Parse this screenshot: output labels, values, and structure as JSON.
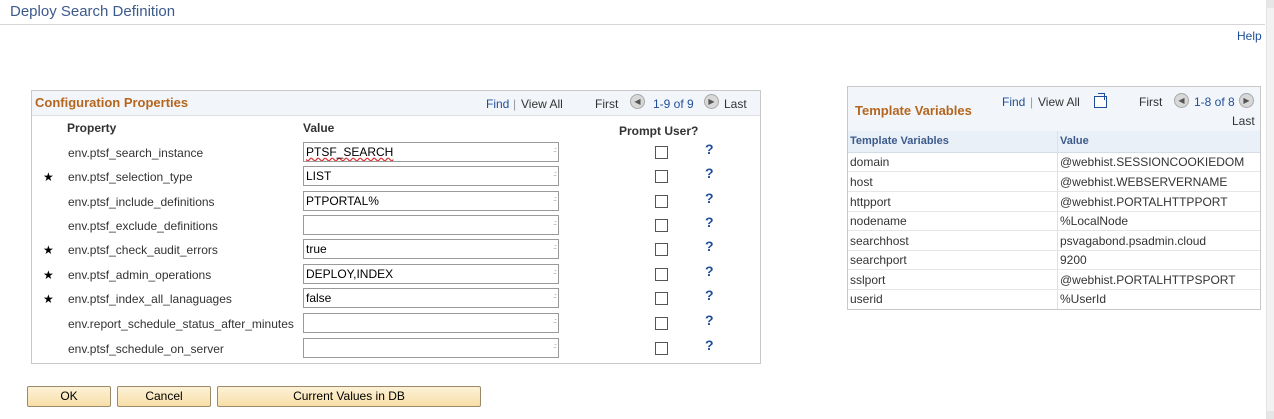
{
  "page": {
    "title": "Deploy Search Definition",
    "help": "Help"
  },
  "config": {
    "title": "Configuration Properties",
    "find": "Find",
    "sep": "|",
    "view_all": "View All",
    "first": "First",
    "count": "1-9 of 9",
    "last": "Last",
    "col_property": "Property",
    "col_value": "Value",
    "col_prompt": "Prompt User?",
    "prompt_icon": "?",
    "rows": [
      {
        "required": false,
        "star": "",
        "property": "env.ptsf_search_instance",
        "value": "PTSF_SEARCH"
      },
      {
        "required": true,
        "star": "★",
        "property": "env.ptsf_selection_type",
        "value": "LIST"
      },
      {
        "required": false,
        "star": "",
        "property": "env.ptsf_include_definitions",
        "value": "PTPORTAL%"
      },
      {
        "required": false,
        "star": "",
        "property": "env.ptsf_exclude_definitions",
        "value": ""
      },
      {
        "required": true,
        "star": "★",
        "property": "env.ptsf_check_audit_errors",
        "value": "true"
      },
      {
        "required": true,
        "star": "★",
        "property": "env.ptsf_admin_operations",
        "value": "DEPLOY,INDEX"
      },
      {
        "required": true,
        "star": "★",
        "property": "env.ptsf_index_all_lanaguages",
        "value": "false"
      },
      {
        "required": false,
        "star": "",
        "property": "env.report_schedule_status_after_minutes",
        "value": ""
      },
      {
        "required": false,
        "star": "",
        "property": "env.ptsf_schedule_on_server",
        "value": ""
      }
    ]
  },
  "buttons": {
    "ok": "OK",
    "cancel": "Cancel",
    "current": "Current Values in DB"
  },
  "template": {
    "title": "Template Variables",
    "find": "Find",
    "sep": "|",
    "view_all": "View All",
    "first": "First",
    "count": "1-8 of 8",
    "last": "Last",
    "col_name": "Template Variables",
    "col_value": "Value",
    "rows": [
      {
        "name": "domain",
        "value": "@webhist.SESSIONCOOKIEDOM"
      },
      {
        "name": "host",
        "value": "@webhist.WEBSERVERNAME"
      },
      {
        "name": "httpport",
        "value": "@webhist.PORTALHTTPPORT"
      },
      {
        "name": "nodename",
        "value": "%LocalNode"
      },
      {
        "name": "searchhost",
        "value": "psvagabond.psadmin.cloud"
      },
      {
        "name": "searchport",
        "value": "9200"
      },
      {
        "name": "sslport",
        "value": "@webhist.PORTALHTTPSPORT"
      },
      {
        "name": "userid",
        "value": "%UserId"
      }
    ]
  },
  "colors": {
    "accent": "#b5661e",
    "link": "#1f4e99",
    "button": "#f7dfa8"
  }
}
